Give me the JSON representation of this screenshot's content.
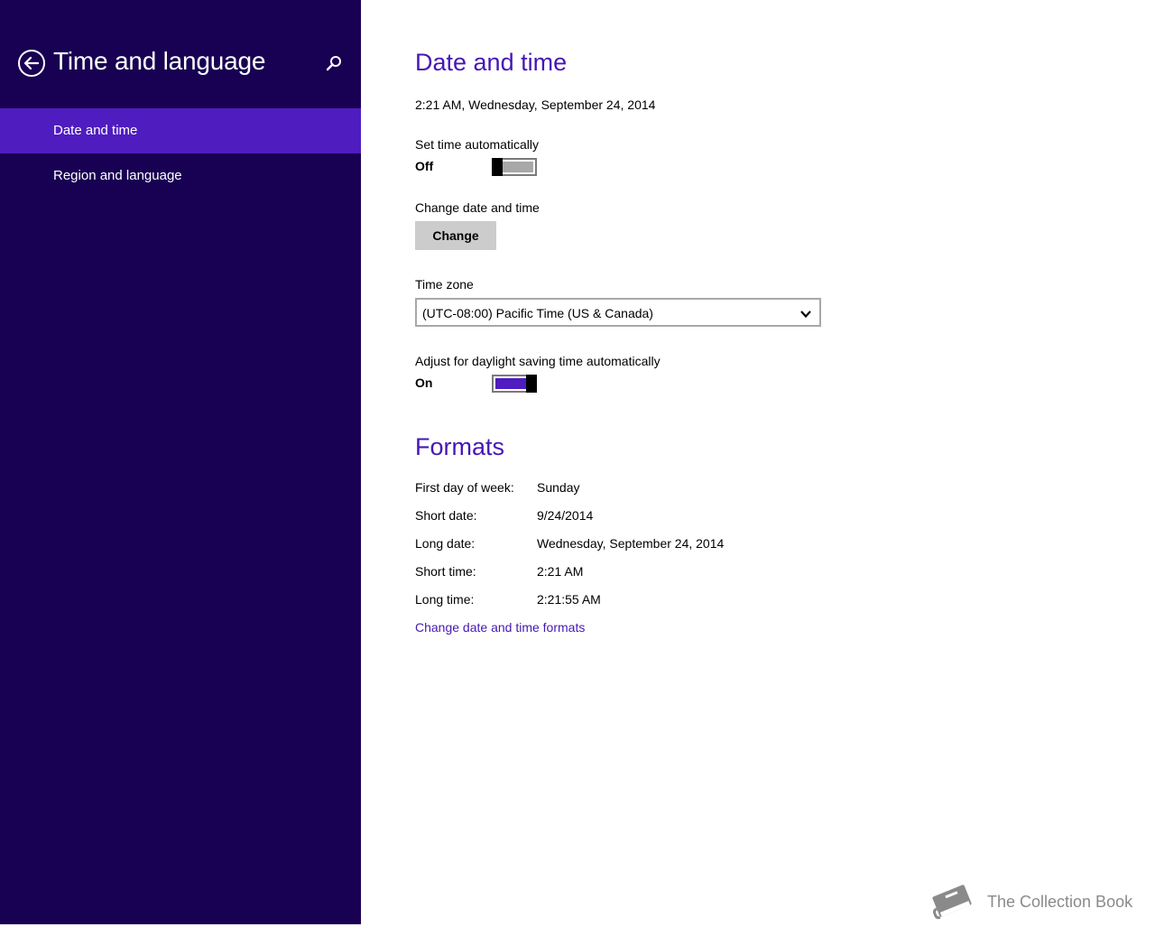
{
  "sidebar": {
    "title": "Time and language",
    "items": [
      {
        "label": "Date and time",
        "active": true
      },
      {
        "label": "Region and language",
        "active": false
      }
    ],
    "background_color": "#180052",
    "active_color": "#4f1cc0"
  },
  "date_time": {
    "heading": "Date and time",
    "current": "2:21 AM, Wednesday, September 24, 2014",
    "set_auto": {
      "label": "Set time automatically",
      "state": "Off"
    },
    "change": {
      "label": "Change date and time",
      "button": "Change"
    },
    "time_zone": {
      "label": "Time zone",
      "value": "(UTC-08:00) Pacific Time (US & Canada)"
    },
    "dst": {
      "label": "Adjust for daylight saving time automatically",
      "state": "On"
    }
  },
  "formats": {
    "heading": "Formats",
    "rows": [
      {
        "label": "First day of week:",
        "value": "Sunday"
      },
      {
        "label": "Short date:",
        "value": "9/24/2014"
      },
      {
        "label": "Long date:",
        "value": "Wednesday, September 24, 2014"
      },
      {
        "label": "Short time:",
        "value": "2:21 AM"
      },
      {
        "label": "Long time:",
        "value": "2:21:55 AM"
      }
    ],
    "link": "Change date and time formats"
  },
  "watermark": {
    "text": "The Collection Book"
  },
  "accent_color": "#4617b4"
}
